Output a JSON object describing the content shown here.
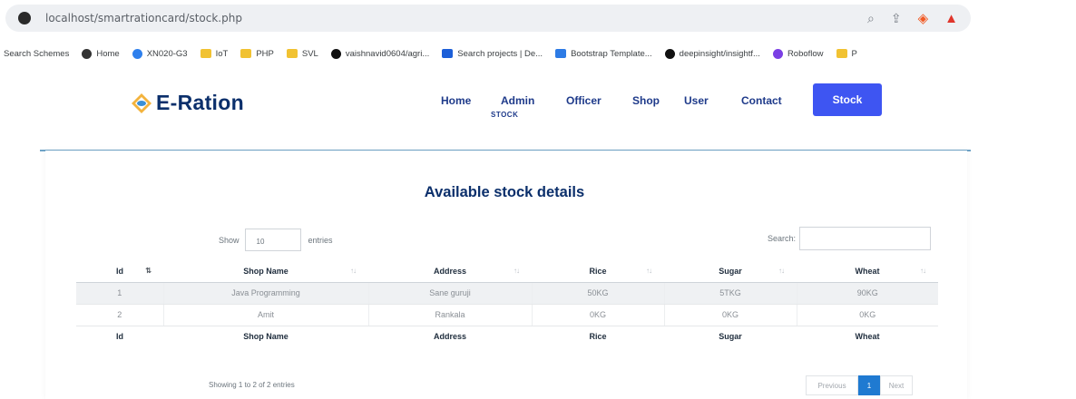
{
  "browser": {
    "url": "localhost/smartrationcard/stock.php",
    "bookmarks": [
      {
        "label": "Search Schemes",
        "icon": "none"
      },
      {
        "label": "Home",
        "icon": "globe-icon"
      },
      {
        "label": "XN020-G3",
        "icon": "link-icon"
      },
      {
        "label": "IoT",
        "icon": "folder-icon"
      },
      {
        "label": "PHP",
        "icon": "folder-icon"
      },
      {
        "label": "SVL",
        "icon": "folder-icon"
      },
      {
        "label": "vaishnavid0604/agri...",
        "icon": "github-icon"
      },
      {
        "label": "Search projects | De...",
        "icon": "page-icon"
      },
      {
        "label": "Bootstrap Template...",
        "icon": "bootstrap-icon"
      },
      {
        "label": "deepinsight/insightf...",
        "icon": "github-icon"
      },
      {
        "label": "Roboflow",
        "icon": "roboflow-icon"
      },
      {
        "label": "P",
        "icon": "folder-icon"
      }
    ]
  },
  "site": {
    "brand": "E-Ration",
    "nav": {
      "home": "Home",
      "admin": "Admin",
      "officer": "Officer",
      "shop": "Shop",
      "user": "User",
      "contact": "Contact",
      "admin_sub": "STOCK",
      "stock_button": "Stock"
    }
  },
  "main": {
    "heading": "Available stock details",
    "show_label": "Show",
    "show_value": "10",
    "entries_label": "entries",
    "search_label": "Search:",
    "search_value": "",
    "columns": [
      "Id",
      "Shop Name",
      "Address",
      "Rice",
      "Sugar",
      "Wheat"
    ],
    "rows": [
      [
        "1",
        "Java Programming",
        "Sane guruji",
        "50KG",
        "5TKG",
        "90KG"
      ],
      [
        "2",
        "Amit",
        "Rankala",
        "0KG",
        "0KG",
        "0KG"
      ]
    ],
    "footer_columns": [
      "Id",
      "Shop Name",
      "Address",
      "Rice",
      "Sugar",
      "Wheat"
    ],
    "info": "Showing 1 to 2 of 2 entries",
    "pager": {
      "previous": "Previous",
      "current": "1",
      "next": "Next"
    }
  },
  "colors": {
    "brand_text": "#0b2f6b",
    "stock_button_bg": "#3e55f2",
    "pager_active": "#1f7ad1"
  }
}
